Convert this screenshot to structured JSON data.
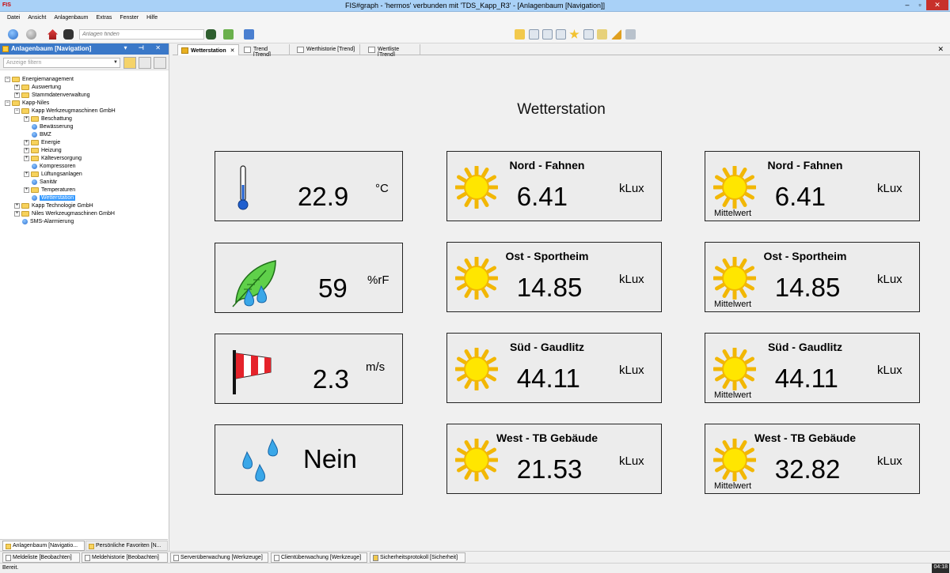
{
  "window": {
    "app_icon": "FIS",
    "title": "FIS#graph - 'hermos' verbunden mit 'TDS_Kapp_R3' - [Anlagenbaum [Navigation]]",
    "minimize": "–",
    "restore": "▫",
    "close": "✕"
  },
  "menu": [
    "Datei",
    "Ansicht",
    "Anlagenbaum",
    "Extras",
    "Fenster",
    "Hilfe"
  ],
  "toolbar": {
    "search_placeholder": "Anlagen finden"
  },
  "left_panel": {
    "header": "Anlagenbaum [Navigation]",
    "header_buttons": "▾ ⊣ ✕",
    "filter_placeholder": "Anzeige filtern",
    "tree": [
      {
        "label": "Energiemanagement",
        "level": 0,
        "expand": "−",
        "type": "folder"
      },
      {
        "label": "Auswertung",
        "level": 1,
        "expand": "+",
        "type": "folder"
      },
      {
        "label": "Stammdatenverwaltung",
        "level": 1,
        "expand": "+",
        "type": "folder"
      },
      {
        "label": "Kapp-Niles",
        "level": 0,
        "expand": "−",
        "type": "folder"
      },
      {
        "label": "Kapp Werkzeugmaschinen GmbH",
        "level": 1,
        "expand": "−",
        "type": "folder"
      },
      {
        "label": "Beschattung",
        "level": 2,
        "expand": "+",
        "type": "folder"
      },
      {
        "label": "Bewässerung",
        "level": 2,
        "expand": "",
        "type": "leaf"
      },
      {
        "label": "BMZ",
        "level": 2,
        "expand": "",
        "type": "leaf"
      },
      {
        "label": "Energie",
        "level": 2,
        "expand": "+",
        "type": "folder"
      },
      {
        "label": "Heizung",
        "level": 2,
        "expand": "+",
        "type": "folder"
      },
      {
        "label": "Kälteversorgung",
        "level": 2,
        "expand": "+",
        "type": "folder"
      },
      {
        "label": "Kompressoren",
        "level": 2,
        "expand": "",
        "type": "leaf"
      },
      {
        "label": "Lüftungsanlagen",
        "level": 2,
        "expand": "+",
        "type": "folder"
      },
      {
        "label": "Sanitär",
        "level": 2,
        "expand": "",
        "type": "leaf"
      },
      {
        "label": "Temperaturen",
        "level": 2,
        "expand": "+",
        "type": "folder"
      },
      {
        "label": "Wetterstation",
        "level": 2,
        "expand": "",
        "type": "leaf",
        "selected": true
      },
      {
        "label": "Kapp Technologie GmbH",
        "level": 1,
        "expand": "+",
        "type": "folder"
      },
      {
        "label": "Niles Werkzeugmaschinen GmbH",
        "level": 1,
        "expand": "+",
        "type": "folder"
      },
      {
        "label": "SMS-Alarmierung",
        "level": 1,
        "expand": "",
        "type": "leaf"
      }
    ],
    "bottom_tabs": [
      "Anlagenbaum [Navigatio...",
      "Persönliche Favoriten [N..."
    ]
  },
  "tabs": [
    {
      "label": "Wetterstation",
      "close": "✕",
      "active": true
    },
    {
      "label": "Trend [Trend]"
    },
    {
      "label": "Werthistorie [Trend]"
    },
    {
      "label": "Wertliste [Trend]"
    }
  ],
  "tabstrip_close": "✕",
  "main": {
    "title": "Wetterstation",
    "left_cards": [
      {
        "icon": "thermometer-icon",
        "value": "22.9",
        "unit": "°C"
      },
      {
        "icon": "leaf-drops-icon",
        "value": "59",
        "unit": "%rF"
      },
      {
        "icon": "windsock-icon",
        "value": "2.3",
        "unit": "m/s"
      },
      {
        "icon": "raindrops-icon",
        "value": "Nein",
        "unit": ""
      }
    ],
    "center_cards": [
      {
        "heading": "Nord - Fahnen",
        "value": "6.41",
        "unit": "kLux"
      },
      {
        "heading": "Ost - Sportheim",
        "value": "14.85",
        "unit": "kLux"
      },
      {
        "heading": "Süd - Gaudlitz",
        "value": "44.11",
        "unit": "kLux"
      },
      {
        "heading": "West - TB Gebäude",
        "value": "21.53",
        "unit": "kLux"
      }
    ],
    "right_cards": [
      {
        "heading": "Nord - Fahnen",
        "value": "6.41",
        "unit": "kLux",
        "note": "Mittelwert"
      },
      {
        "heading": "Ost - Sportheim",
        "value": "14.85",
        "unit": "kLux",
        "note": "Mittelwert"
      },
      {
        "heading": "Süd - Gaudlitz",
        "value": "44.11",
        "unit": "kLux",
        "note": "Mittelwert"
      },
      {
        "heading": "West - TB Gebäude",
        "value": "32.82",
        "unit": "kLux",
        "note": "Mittelwert"
      }
    ]
  },
  "bottom_tabs": [
    "Meldeliste [Beobachten]",
    "Meldehistorie [Beobachten]",
    "Serverüberwachung [Werkzeuge]",
    "Clientüberwachung [Werkzeuge]",
    "Sicherheitsprotokoll [Sicherheit]"
  ],
  "status": {
    "text": "Bereit.",
    "clock": "04:18"
  }
}
